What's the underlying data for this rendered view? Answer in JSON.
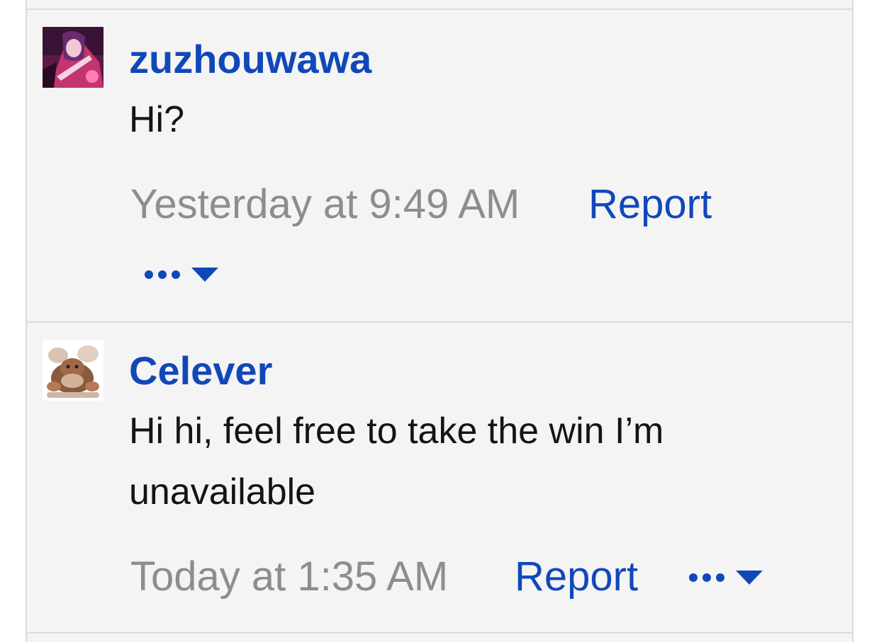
{
  "comments": [
    {
      "username": "zuzhouwawa",
      "avatar_icon": "anime-character-avatar-icon",
      "lines": [
        "Hi?"
      ],
      "timestamp": "Yesterday at 9:49 AM",
      "report_label": "Report",
      "more_icon": "more-options-caret-icon"
    },
    {
      "username": "Celever",
      "avatar_icon": "bear-cartoon-avatar-icon",
      "lines": [
        "Hi hi, feel free to take the win I’m",
        "unavailable"
      ],
      "timestamp": "Today at 1:35 AM",
      "report_label": "Report",
      "more_icon": "more-options-caret-icon"
    }
  ],
  "colors": {
    "link": "#1148b9",
    "text": "#141414",
    "muted": "#8d8d8d",
    "panel": "#f4f4f4",
    "border": "#dcdcdc"
  }
}
